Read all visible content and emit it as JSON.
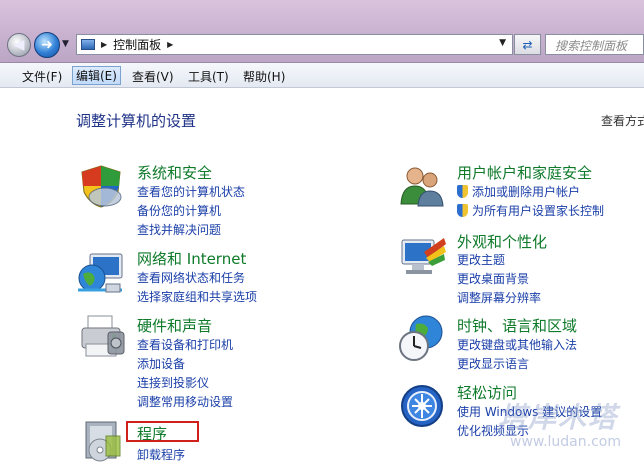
{
  "address": {
    "breadcrumb": "控制面板",
    "search_placeholder": "搜索控制面板"
  },
  "menu": [
    {
      "label": "文件(F)"
    },
    {
      "label": "编辑(E)"
    },
    {
      "label": "查看(V)"
    },
    {
      "label": "工具(T)"
    },
    {
      "label": "帮助(H)"
    }
  ],
  "page": {
    "heading": "调整计算机的设置",
    "view_by": "查看方式"
  },
  "categories": {
    "security": {
      "title": "系统和安全",
      "links": [
        "查看您的计算机状态",
        "备份您的计算机",
        "查找并解决问题"
      ],
      "icon": "shield-icon"
    },
    "network": {
      "title": "网络和 Internet",
      "links": [
        "查看网络状态和任务",
        "选择家庭组和共享选项"
      ],
      "icon": "globe-network-icon"
    },
    "hardware": {
      "title": "硬件和声音",
      "links": [
        "查看设备和打印机",
        "添加设备",
        "连接到投影仪",
        "调整常用移动设置"
      ],
      "icon": "printer-icon"
    },
    "programs": {
      "title": "程序",
      "links": [
        "卸载程序"
      ],
      "icon": "programs-icon"
    },
    "users": {
      "title": "用户帐户和家庭安全",
      "links": [
        "添加或删除用户帐户",
        "为所有用户设置家长控制"
      ],
      "icon": "users-icon"
    },
    "appearance": {
      "title": "外观和个性化",
      "links": [
        "更改主题",
        "更改桌面背景",
        "调整屏幕分辨率"
      ],
      "icon": "monitor-palette-icon"
    },
    "clock": {
      "title": "时钟、语言和区域",
      "links": [
        "更改键盘或其他输入法",
        "更改显示语言"
      ],
      "icon": "clock-globe-icon"
    },
    "access": {
      "title": "轻松访问",
      "links": [
        "使用 Windows 建议的设置",
        "优化视频显示"
      ],
      "icon": "ease-of-access-icon"
    }
  },
  "colors": {
    "category_title": "#0e7a2a",
    "link": "#1a3fa8",
    "heading": "#1e3287",
    "highlight_box": "#d0201c"
  },
  "watermark": {
    "text": "塔岸木塔",
    "url": "www.ludan.com"
  }
}
